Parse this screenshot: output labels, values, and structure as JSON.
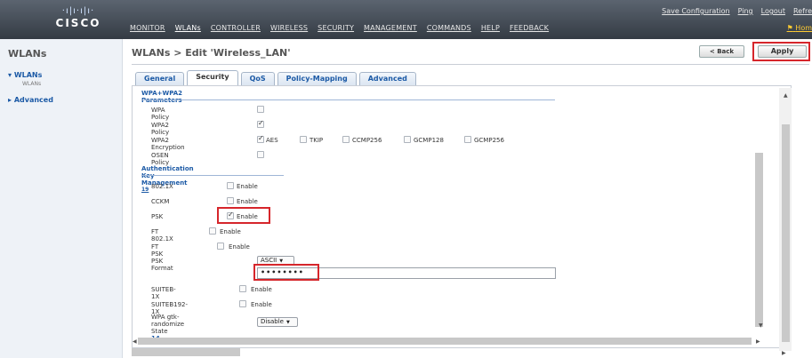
{
  "brand": {
    "logo_bars": "·ı|ı·ı|ı·",
    "logo_text": "CISCO"
  },
  "topbar": {
    "nav": [
      "MONITOR",
      "WLANs",
      "CONTROLLER",
      "WIRELESS",
      "SECURITY",
      "MANAGEMENT",
      "COMMANDS",
      "HELP",
      "FEEDBACK"
    ],
    "active_nav": "WLANs",
    "utility": [
      "Save Configuration",
      "Ping",
      "Logout",
      "Refre"
    ],
    "home": "Hom"
  },
  "sidebar": {
    "title": "WLANs",
    "items": [
      {
        "label": "WLANs",
        "expanded": true,
        "sub": "WLANs"
      },
      {
        "label": "Advanced",
        "expanded": false
      }
    ]
  },
  "page": {
    "title": "WLANs > Edit  'Wireless_LAN'",
    "back_label": "< Back",
    "apply_label": "Apply"
  },
  "tabs": [
    "General",
    "Security",
    "QoS",
    "Policy-Mapping",
    "Advanced"
  ],
  "active_tab": "Security",
  "wpa": {
    "heading": "WPA+WPA2 Parameters",
    "rows": [
      {
        "label": "WPA Policy",
        "checked": false
      },
      {
        "label": "WPA2 Policy",
        "checked": true
      },
      {
        "label": "WPA2 Encryption"
      },
      {
        "label": "OSEN Policy",
        "checked": false
      }
    ],
    "encryption": [
      {
        "label": "AES",
        "checked": true
      },
      {
        "label": "TKIP",
        "checked": false
      },
      {
        "label": "CCMP256",
        "checked": false
      },
      {
        "label": "GCMP128",
        "checked": false
      },
      {
        "label": "GCMP256",
        "checked": false
      }
    ]
  },
  "akm": {
    "heading": "Authentication Key Management",
    "footnote": "19",
    "enable_label": "Enable",
    "rows": [
      {
        "label": "802.1X",
        "checked": false
      },
      {
        "label": "CCKM",
        "checked": false
      },
      {
        "label": "PSK",
        "checked": true
      },
      {
        "label": "FT 802.1X",
        "checked": false
      },
      {
        "label": "FT PSK",
        "checked": false
      }
    ],
    "psk_format_label": "PSK Format",
    "psk_format_value": "ASCII",
    "psk_value": "••••••••",
    "suiteb_rows": [
      {
        "label": "SUITEB-1X",
        "checked": false
      },
      {
        "label": "SUITEB192-1X",
        "checked": false
      }
    ],
    "gtk_label": "WPA gtk-randomize State",
    "gtk_footnote": "14",
    "gtk_value": "Disable"
  },
  "colors": {
    "highlight": "#d6262b",
    "link": "#1c5aa6",
    "topbar": "#3e4650"
  }
}
